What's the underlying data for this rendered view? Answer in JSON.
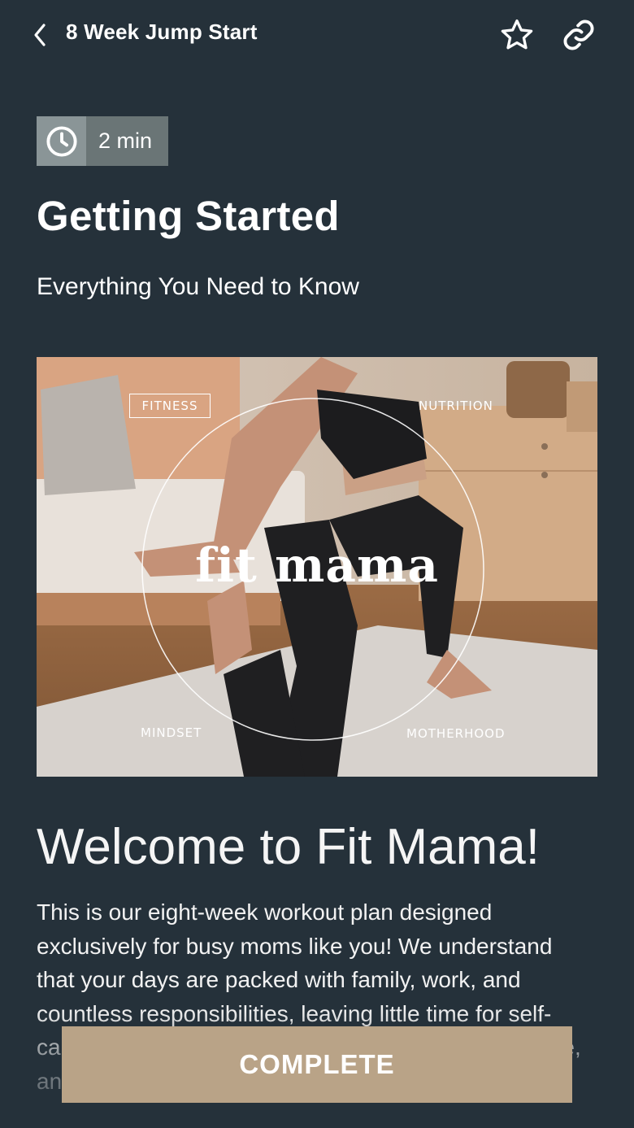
{
  "header": {
    "title": "8 Week Jump Start",
    "back_icon": "chevron-left-icon",
    "favorite_icon": "star-outline-icon",
    "share_icon": "link-icon"
  },
  "lesson": {
    "duration": "2 min",
    "duration_icon": "clock-icon",
    "title": "Getting Started",
    "subtitle": "Everything You Need to Know"
  },
  "hero": {
    "labels": {
      "fitness": "FITNESS",
      "nutrition": "NUTRITION",
      "mindset": "MINDSET",
      "motherhood": "MOTHERHOOD"
    },
    "logo_text": "fit mama"
  },
  "content": {
    "heading": "Welcome to Fit Mama!",
    "body": "This is our eight-week workout plan designed exclusively for busy moms like you! We understand that your days are packed with family, work, and countless responsibilities, leaving little time for self-care. This program is designed to be simple, effective, and to fit seamlessly into your busy schedule."
  },
  "footer": {
    "complete_label": "COMPLETE"
  },
  "colors": {
    "background": "#25313a",
    "accent": "#b9a387",
    "chip_icon_bg": "#8a9597",
    "chip_text_bg": "#6a7576"
  }
}
